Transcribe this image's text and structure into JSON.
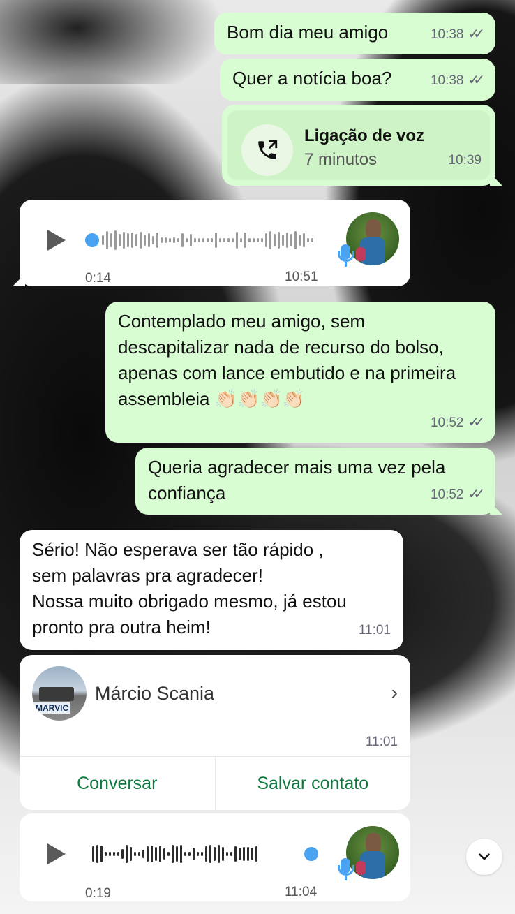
{
  "messages": [
    {
      "text": "Bom dia meu amigo",
      "time": "10:38"
    },
    {
      "text": "Quer a notícia boa?",
      "time": "10:38"
    },
    {
      "call_title": "Ligação de voz",
      "call_duration": "7 minutos",
      "time": "10:39"
    },
    {
      "voice_duration": "0:14",
      "time": "10:51"
    },
    {
      "text": "Contemplado meu amigo, sem descapitalizar nada de recurso do bolso, apenas com lance embutido e na primeira assembleia 👏🏻👏🏻👏🏻👏🏻",
      "time": "10:52"
    },
    {
      "text": "Queria agradecer mais uma vez pela confiança",
      "time": "10:52"
    },
    {
      "text": "Sério! Não esperava ser tão rápido ,\nsem palavras pra agradecer!\nNossa muito obrigado mesmo, já estou pronto pra outra heim!",
      "time": "11:01"
    },
    {
      "contact_name": "Márcio Scania",
      "time": "11:01",
      "action_chat": "Conversar",
      "action_save": "Salvar contato",
      "avatar_text": "MARVIC"
    },
    {
      "voice_duration": "0:19",
      "time": "11:04"
    }
  ],
  "icons": {
    "ticks": "double-check-icon",
    "call": "outgoing-call-icon",
    "play": "play-icon",
    "mic": "mic-icon",
    "chevron": "chevron-right-icon",
    "scroll": "chevron-down-icon"
  },
  "colors": {
    "outgoing_bubble": "#d9fdd3",
    "incoming_bubble": "#ffffff",
    "accent_green": "#0f7a3f",
    "blue": "#4aa3f0"
  }
}
